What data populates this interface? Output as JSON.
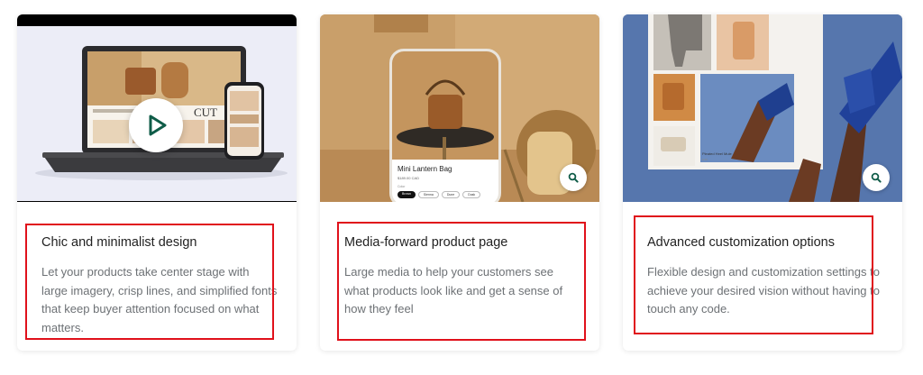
{
  "cards": [
    {
      "title": "Chic and minimalist design",
      "description": "Let your products take center stage with large imagery, crisp lines, and simplified fonts that keep buyer attention focused on what matters.",
      "media_type": "video",
      "thumbnail": {
        "brand_text": "CUT"
      }
    },
    {
      "title": "Media-forward product page",
      "description": "Large media to help your customers see what products look like and get a sense of how they feel",
      "media_type": "image",
      "mockup": {
        "product_name": "Mini Lantern Bag",
        "price": "$189.00 CAD",
        "variant_label": "Color",
        "variants": [
          "Brown",
          "Sienna",
          "Dune",
          "Dusk"
        ]
      }
    },
    {
      "title": "Advanced customization options",
      "description": "Flexible design and customization settings to achieve your desired vision without having to touch any code.",
      "media_type": "image",
      "mockup": {
        "caption": "Pleated Heel Mule",
        "sub": "$ 98"
      }
    }
  ],
  "colors": {
    "highlight": "#e0111b",
    "accent": "#0f5c48",
    "title": "#222222",
    "text": "#6d7175"
  },
  "icons": {
    "play": "play-icon",
    "zoom": "magnifier-icon"
  }
}
